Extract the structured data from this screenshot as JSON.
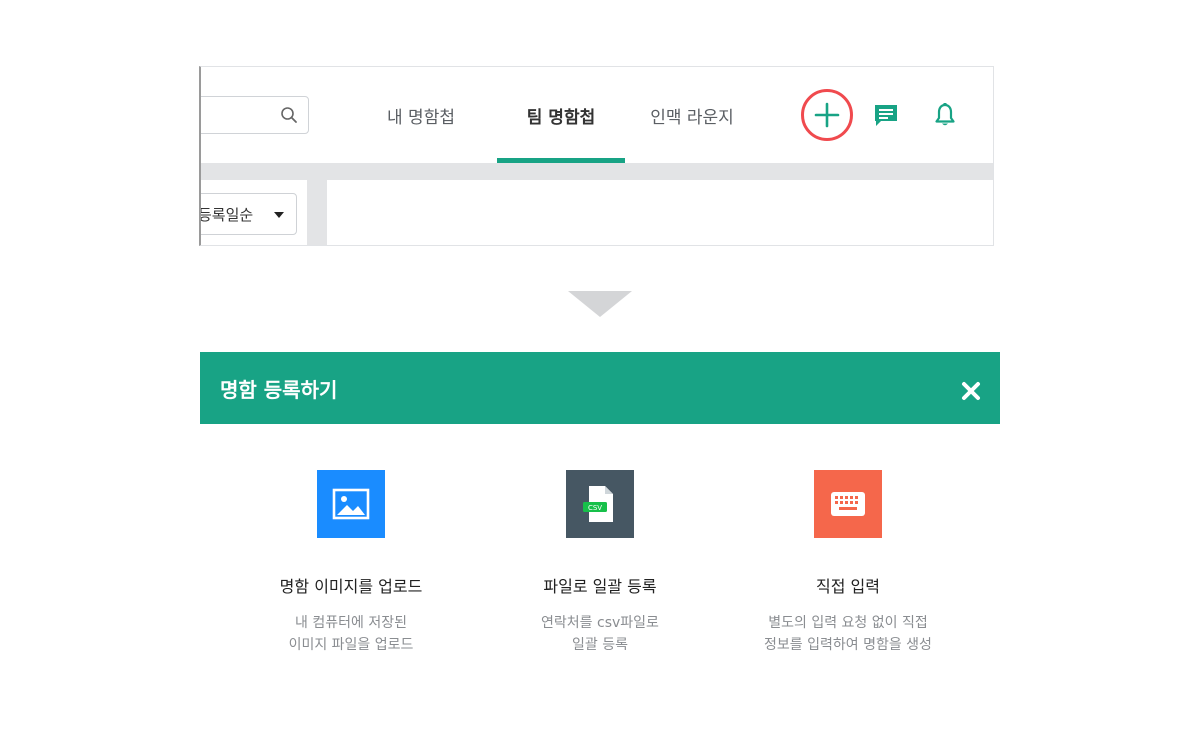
{
  "top_bar": {
    "tabs": [
      "내 명함첩",
      "팀 명함첩",
      "인맥 라운지"
    ],
    "active_tab": "팀 명함첩",
    "sort_label": "등록일순"
  },
  "dialog": {
    "title": "명함 등록하기",
    "options": [
      {
        "title": "명함 이미지를 업로드",
        "desc": [
          "내 컴퓨터에 저장된",
          "이미지 파일을 업로드"
        ],
        "icon": "image-icon",
        "color": "#1a8cff"
      },
      {
        "title": "파일로 일괄 등록",
        "desc": [
          "연락처를 csv파일로",
          "일괄 등록"
        ],
        "icon": "csv-file-icon",
        "color": "#465763",
        "badge": "CSV"
      },
      {
        "title": "직접 입력",
        "desc": [
          "별도의 입력 요청 없이 직접",
          "정보를 입력하여 명함을 생성"
        ],
        "icon": "keyboard-icon",
        "color": "#f5674b"
      }
    ]
  },
  "colors": {
    "accent": "#18a385",
    "highlight_ring": "#f04a4e"
  }
}
